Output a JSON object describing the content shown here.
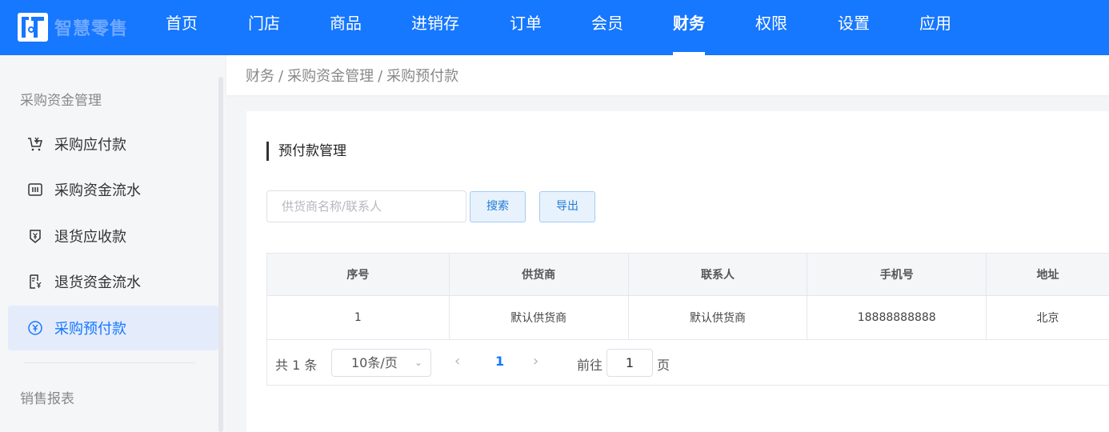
{
  "app": {
    "logo_text": "智慧零售"
  },
  "nav": {
    "items": [
      "首页",
      "门店",
      "商品",
      "进销存",
      "订单",
      "会员",
      "财务",
      "权限",
      "设置",
      "应用"
    ],
    "active": "财务"
  },
  "sidebar": {
    "group1_title": "采购资金管理",
    "items": [
      {
        "label": "采购应付款",
        "icon": "cart-icon"
      },
      {
        "label": "采购资金流水",
        "icon": "ledger-icon"
      },
      {
        "label": "退货应收款",
        "icon": "yen-shield-icon"
      },
      {
        "label": "退货资金流水",
        "icon": "receipt-yen-icon"
      },
      {
        "label": "采购预付款",
        "icon": "yen-circle-icon",
        "active": true
      }
    ],
    "group2_title": "销售报表"
  },
  "breadcrumb": {
    "items": [
      "财务",
      "采购资金管理",
      "采购预付款"
    ],
    "separator": "/"
  },
  "main": {
    "section_title": "预付款管理",
    "search": {
      "placeholder": "供货商名称/联系人",
      "value": ""
    },
    "search_button": "搜索",
    "export_button": "导出",
    "table": {
      "columns": [
        "序号",
        "供货商",
        "联系人",
        "手机号",
        "地址"
      ],
      "rows": [
        [
          "1",
          "默认供货商",
          "默认供货商",
          "18888888888",
          "北京"
        ]
      ]
    },
    "pagination": {
      "total_text": "共 1 条",
      "page_size": "10条/页",
      "current_page": "1",
      "goto_label": "前往",
      "goto_value": "1",
      "page_suffix": "页"
    }
  },
  "colors": {
    "primary": "#1677ff",
    "active_bg": "#e4ecfc"
  }
}
